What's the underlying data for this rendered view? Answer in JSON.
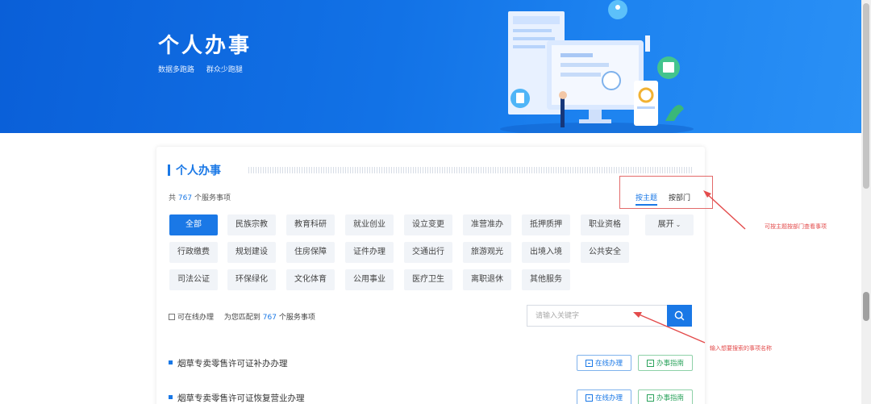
{
  "banner": {
    "title": "个人办事",
    "slogans": [
      "数据多跑路",
      "群众少跑腿"
    ],
    "colors": {
      "banner_blue": "#1272e6"
    }
  },
  "panel": {
    "heading": "个人办事",
    "count_prefix": "共",
    "count_value": "767",
    "count_suffix": "个服务事项",
    "tabs": [
      {
        "label": "按主题",
        "active": true
      },
      {
        "label": "按部门",
        "active": false
      }
    ]
  },
  "categories": [
    [
      "全部",
      "民族宗教",
      "教育科研",
      "就业创业",
      "设立变更",
      "准营准办",
      "抵押质押",
      "职业资格",
      "展开"
    ],
    [
      "行政缴费",
      "规划建设",
      "住房保障",
      "证件办理",
      "交通出行",
      "旅游观光",
      "出境入境",
      "公共安全"
    ],
    [
      "司法公证",
      "环保绿化",
      "文化体育",
      "公用事业",
      "医疗卫生",
      "离职退休",
      "其他服务"
    ]
  ],
  "filter": {
    "online_label": "可在线办理",
    "match_prefix": "为您匹配到",
    "match_value": "767",
    "match_suffix": "个服务事项"
  },
  "search": {
    "placeholder": "请输入关键字",
    "icon": "search-icon"
  },
  "items": [
    {
      "name": "烟草专卖零售许可证补办办理",
      "online": "在线办理",
      "guide": "办事指南"
    },
    {
      "name": "烟草专卖零售许可证恢复营业办理",
      "online": "在线办理",
      "guide": "办事指南"
    }
  ],
  "annotations": {
    "tab_note": "可按主题按部门查看事项",
    "search_note": "输入想要搜索的事项名称"
  },
  "colors": {
    "accent": "#1a78e6",
    "annotation_red": "#e34b4b",
    "guide_green": "#2aa25b"
  }
}
